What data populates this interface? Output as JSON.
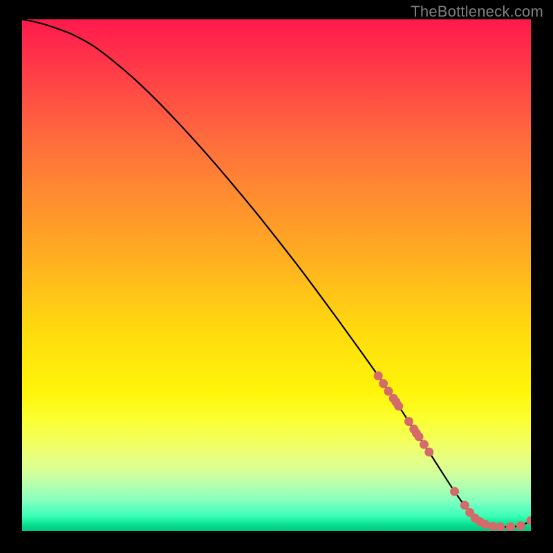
{
  "watermark": "TheBottleneck.com",
  "chart_data": {
    "type": "line",
    "title": "",
    "xlabel": "",
    "ylabel": "",
    "xlim": [
      0,
      100
    ],
    "ylim": [
      0,
      100
    ],
    "grid": false,
    "curve_color": "#000000",
    "marker_color": "#d46a6a",
    "x": [
      0,
      3,
      6,
      10,
      14,
      18,
      22,
      26,
      30,
      34,
      38,
      42,
      46,
      50,
      54,
      58,
      62,
      66,
      70,
      73,
      76,
      78,
      80,
      82,
      85,
      88,
      90,
      92,
      94,
      96,
      98,
      100
    ],
    "y": [
      100,
      99.4,
      98.5,
      97.0,
      94.8,
      91.8,
      88.4,
      84.6,
      80.5,
      76.2,
      71.7,
      67.0,
      62.2,
      57.2,
      52.1,
      46.8,
      41.4,
      35.9,
      30.3,
      25.9,
      21.4,
      18.4,
      15.4,
      12.3,
      7.7,
      3.6,
      1.8,
      1.0,
      0.8,
      0.8,
      1.0,
      2.0
    ],
    "markers": [
      {
        "x": 70,
        "y": 30.3
      },
      {
        "x": 71,
        "y": 28.8
      },
      {
        "x": 72,
        "y": 27.3
      },
      {
        "x": 73,
        "y": 25.9
      },
      {
        "x": 73.5,
        "y": 25.2
      },
      {
        "x": 74,
        "y": 24.4
      },
      {
        "x": 76,
        "y": 21.4
      },
      {
        "x": 77,
        "y": 19.9
      },
      {
        "x": 77.5,
        "y": 19.1
      },
      {
        "x": 78,
        "y": 18.4
      },
      {
        "x": 79,
        "y": 16.9
      },
      {
        "x": 80,
        "y": 15.4
      },
      {
        "x": 85,
        "y": 7.7
      },
      {
        "x": 87,
        "y": 5.0
      },
      {
        "x": 88,
        "y": 3.6
      },
      {
        "x": 89,
        "y": 2.5
      },
      {
        "x": 90,
        "y": 1.8
      },
      {
        "x": 91,
        "y": 1.3
      },
      {
        "x": 92.5,
        "y": 0.9
      },
      {
        "x": 94,
        "y": 0.8
      },
      {
        "x": 96,
        "y": 0.8
      },
      {
        "x": 98,
        "y": 1.0
      },
      {
        "x": 100,
        "y": 2.0
      }
    ]
  }
}
